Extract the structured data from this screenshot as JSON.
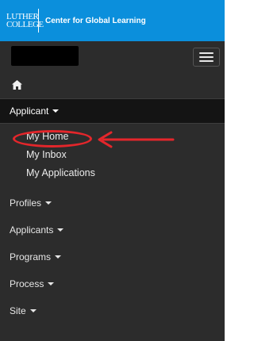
{
  "brand": {
    "logo_line1": "LUTHER",
    "logo_line2": "COLLEGE",
    "name": "Center for Global Learning",
    "bar_color": "#0b8fdc"
  },
  "nav": {
    "home_icon": "home-icon",
    "menu_icon": "hamburger-icon",
    "sections": [
      {
        "label": "Applicant",
        "active": true,
        "children": [
          "My Home",
          "My Inbox",
          "My Applications"
        ]
      },
      {
        "label": "Profiles"
      },
      {
        "label": "Applicants"
      },
      {
        "label": "Programs"
      },
      {
        "label": "Process"
      },
      {
        "label": "Site"
      }
    ]
  },
  "annotation": {
    "target": "My Home",
    "color": "#e4262b"
  }
}
